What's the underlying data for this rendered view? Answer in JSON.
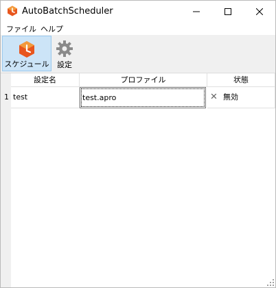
{
  "window": {
    "title": "AutoBatchScheduler"
  },
  "menu": {
    "items": [
      "ファイル",
      "ヘルプ"
    ]
  },
  "toolbar": {
    "schedule_label": "スケジュール",
    "settings_label": "設定"
  },
  "grid": {
    "columns": [
      "設定名",
      "プロファイル",
      "状態"
    ],
    "rows": [
      {
        "num": "1",
        "name": "test",
        "profile": "test.apro",
        "status_icon": "close-icon",
        "status": "無効"
      }
    ]
  },
  "colors": {
    "accent": "#e8561e",
    "selected_bg": "#cce4f7",
    "toolbar_bg": "#f0f0f0"
  }
}
